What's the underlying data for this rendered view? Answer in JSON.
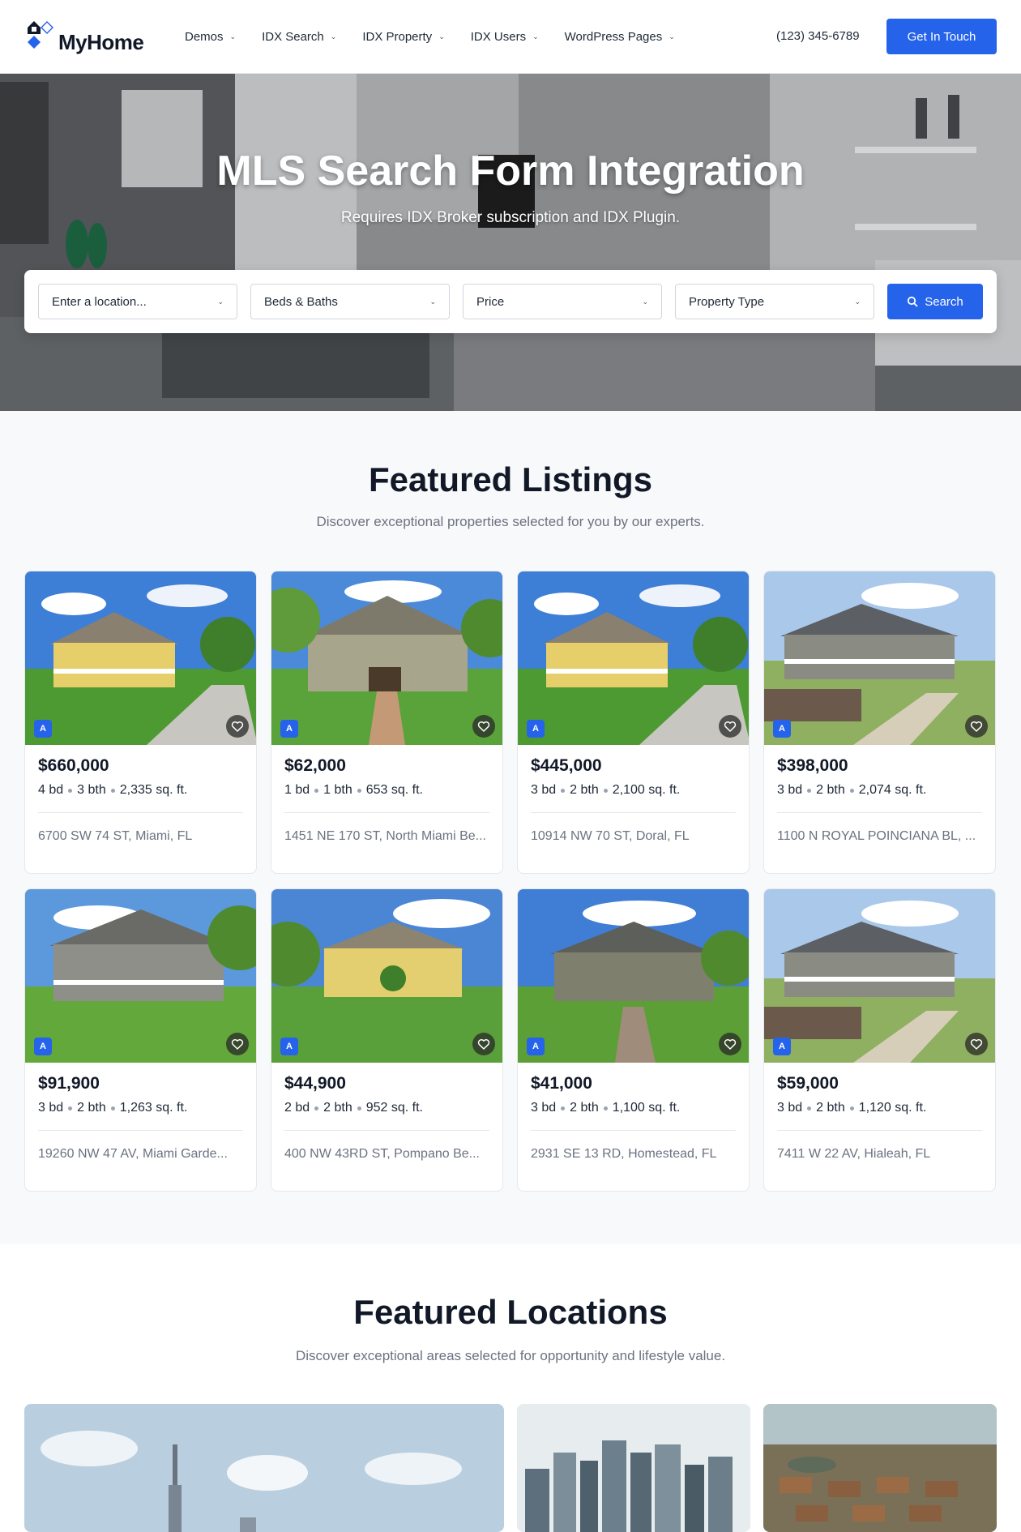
{
  "header": {
    "logo_text": "MyHome",
    "nav": [
      {
        "label": "Demos"
      },
      {
        "label": "IDX Search"
      },
      {
        "label": "IDX Property"
      },
      {
        "label": "IDX Users"
      },
      {
        "label": "WordPress Pages"
      }
    ],
    "phone": "(123) 345-6789",
    "cta_label": "Get In Touch"
  },
  "hero": {
    "title": "MLS Search Form Integration",
    "subtitle": "Requires IDX Broker subscription and IDX Plugin.",
    "search": {
      "location_placeholder": "Enter a location...",
      "beds_baths": "Beds & Baths",
      "price": "Price",
      "property_type": "Property Type",
      "button_label": "Search"
    }
  },
  "featured_listings": {
    "title": "Featured Listings",
    "subtitle": "Discover exceptional properties selected for you by our experts.",
    "badge": "A",
    "items": [
      {
        "price": "$660,000",
        "beds": "4 bd",
        "baths": "3 bth",
        "area": "2,335 sq. ft.",
        "address": "6700 SW 74 ST, Miami, FL"
      },
      {
        "price": "$62,000",
        "beds": "1 bd",
        "baths": "1 bth",
        "area": "653 sq. ft.",
        "address": "1451 NE 170 ST, North Miami Be..."
      },
      {
        "price": "$445,000",
        "beds": "3 bd",
        "baths": "2 bth",
        "area": "2,100 sq. ft.",
        "address": "10914 NW 70 ST, Doral, FL"
      },
      {
        "price": "$398,000",
        "beds": "3 bd",
        "baths": "2 bth",
        "area": "2,074 sq. ft.",
        "address": "1100 N ROYAL POINCIANA BL, ..."
      },
      {
        "price": "$91,900",
        "beds": "3 bd",
        "baths": "2 bth",
        "area": "1,263 sq. ft.",
        "address": "19260 NW 47 AV, Miami Garde..."
      },
      {
        "price": "$44,900",
        "beds": "2 bd",
        "baths": "2 bth",
        "area": "952 sq. ft.",
        "address": "400 NW 43RD ST, Pompano Be..."
      },
      {
        "price": "$41,000",
        "beds": "3 bd",
        "baths": "2 bth",
        "area": "1,100 sq. ft.",
        "address": "2931 SE 13 RD, Homestead, FL"
      },
      {
        "price": "$59,000",
        "beds": "3 bd",
        "baths": "2 bth",
        "area": "1,120 sq. ft.",
        "address": "7411 W 22 AV, Hialeah, FL"
      }
    ]
  },
  "featured_locations": {
    "title": "Featured Locations",
    "subtitle": "Discover exceptional areas selected for opportunity and lifestyle value."
  },
  "colors": {
    "accent": "#2563eb",
    "text_dark": "#111827",
    "text_muted": "#6b7280"
  }
}
